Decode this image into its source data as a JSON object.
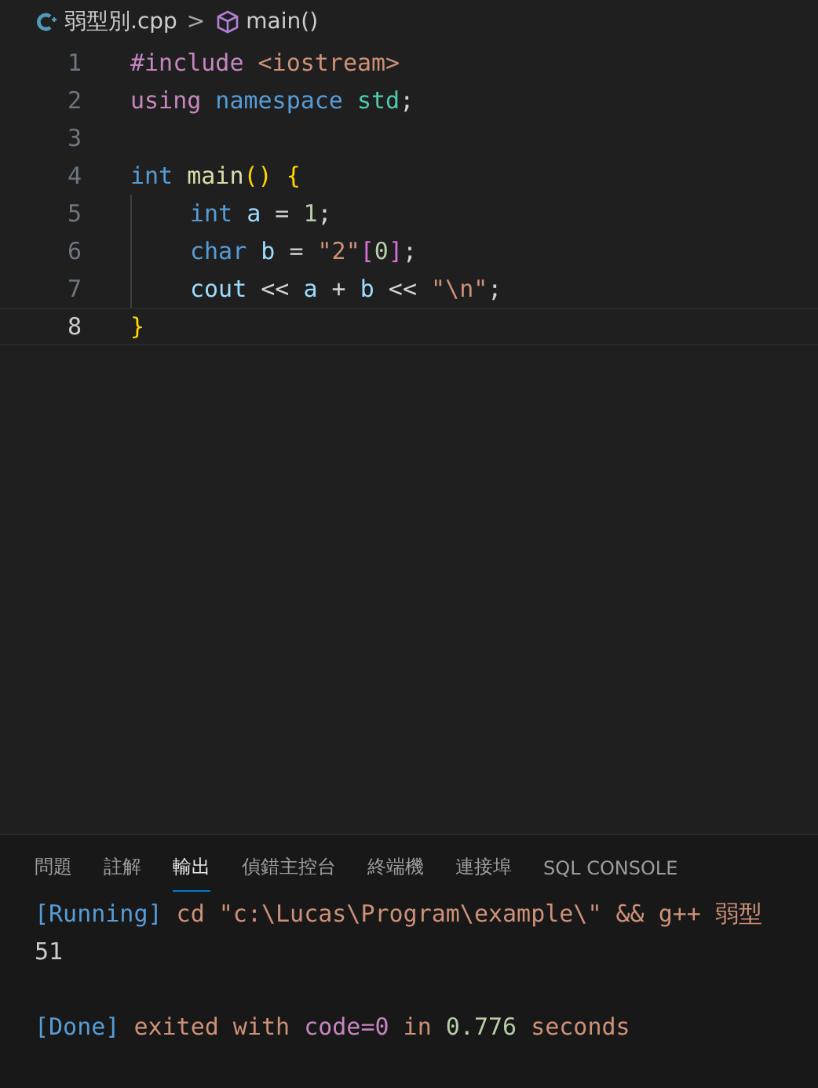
{
  "breadcrumb": {
    "file": "弱型別.cpp",
    "separator": ">",
    "symbol": "main()"
  },
  "code_lines": [
    {
      "number": "1",
      "current": false,
      "indent": false,
      "tokens": [
        {
          "t": "#include",
          "kind": "directive"
        },
        {
          "t": " <iostream>",
          "kind": "string"
        }
      ]
    },
    {
      "number": "2",
      "current": false,
      "indent": false,
      "tokens": [
        {
          "t": "using",
          "kind": "directive"
        },
        {
          "t": " namespace",
          "kind": "keyword"
        },
        {
          "t": " std",
          "kind": "type"
        },
        {
          "t": ";",
          "kind": "plain"
        }
      ]
    },
    {
      "number": "3",
      "current": false,
      "indent": false
    },
    {
      "number": "4",
      "current": false,
      "indent": false,
      "tokens": [
        {
          "t": "int",
          "kind": "keyword"
        },
        {
          "t": " main",
          "kind": "function"
        },
        {
          "t": "()",
          "kind": "bracket"
        },
        {
          "t": " {",
          "kind": "bracket"
        }
      ]
    },
    {
      "number": "5",
      "current": false,
      "indent": true,
      "tokens": [
        {
          "t": "int",
          "kind": "keyword"
        },
        {
          "t": " a",
          "kind": "variable"
        },
        {
          "t": " =",
          "kind": "plain"
        },
        {
          "t": " 1",
          "kind": "number"
        },
        {
          "t": ";",
          "kind": "plain"
        }
      ]
    },
    {
      "number": "6",
      "current": false,
      "indent": true,
      "tokens": [
        {
          "t": "char",
          "kind": "keyword"
        },
        {
          "t": " b",
          "kind": "variable"
        },
        {
          "t": " =",
          "kind": "plain"
        },
        {
          "t": " \"2\"",
          "kind": "string"
        },
        {
          "t": "[",
          "kind": "bracket2"
        },
        {
          "t": "0",
          "kind": "number"
        },
        {
          "t": "]",
          "kind": "bracket2"
        },
        {
          "t": ";",
          "kind": "plain"
        }
      ]
    },
    {
      "number": "7",
      "current": false,
      "indent": true,
      "tokens": [
        {
          "t": "cout",
          "kind": "variable"
        },
        {
          "t": " <<",
          "kind": "plain"
        },
        {
          "t": " a",
          "kind": "variable"
        },
        {
          "t": " +",
          "kind": "plain"
        },
        {
          "t": " b",
          "kind": "variable"
        },
        {
          "t": " <<",
          "kind": "plain"
        },
        {
          "t": " \"\\n\"",
          "kind": "string"
        },
        {
          "t": ";",
          "kind": "plain"
        }
      ]
    },
    {
      "number": "8",
      "current": true,
      "indent": false,
      "tokens": [
        {
          "t": "}",
          "kind": "bracket"
        }
      ]
    }
  ],
  "panel_tabs": [
    {
      "label": "問題",
      "selected": false
    },
    {
      "label": "註解",
      "selected": false
    },
    {
      "label": "輸出",
      "selected": true
    },
    {
      "label": "偵錯主控台",
      "selected": false
    },
    {
      "label": "終端機",
      "selected": false
    },
    {
      "label": "連接埠",
      "selected": false
    },
    {
      "label": "SQL CONSOLE",
      "selected": false
    }
  ],
  "output_lines": [
    {
      "kind": "text",
      "segments": [
        {
          "t": "[Running]",
          "kind": "tag"
        },
        {
          "t": " cd \"c:\\Lucas\\Program\\example\\\" && g++ 弱型",
          "kind": "text"
        }
      ]
    },
    {
      "kind": "text",
      "segments": [
        {
          "t": "51",
          "kind": "plain"
        }
      ]
    },
    {
      "kind": "blank"
    },
    {
      "kind": "text",
      "segments": [
        {
          "t": "[Done]",
          "kind": "tag"
        },
        {
          "t": " exited with",
          "kind": "text"
        },
        {
          "t": " code=0",
          "kind": "code"
        },
        {
          "t": " in",
          "kind": "text"
        },
        {
          "t": " 0.776",
          "kind": "number"
        },
        {
          "t": " seconds",
          "kind": "text"
        }
      ]
    }
  ]
}
